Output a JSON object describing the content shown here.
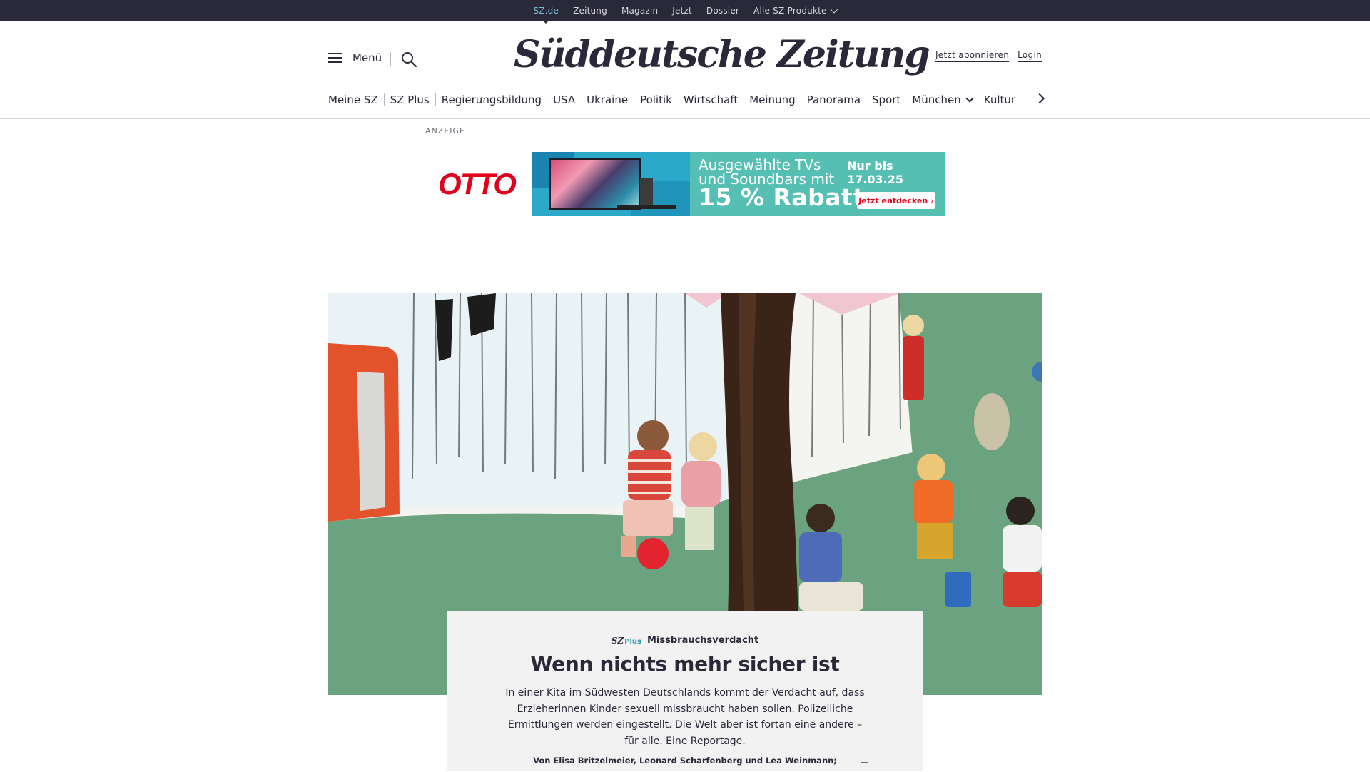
{
  "topbar": {
    "items": [
      {
        "label": "SZ.de",
        "active": true
      },
      {
        "label": "Zeitung"
      },
      {
        "label": "Magazin"
      },
      {
        "label": "Jetzt"
      },
      {
        "label": "Dossier"
      },
      {
        "label": "Alle SZ-Produkte",
        "dropdown": true
      }
    ]
  },
  "header": {
    "menu_label": "Menü",
    "logo": "Süddeutsche Zeitung",
    "subscribe": "Jetzt abonnieren",
    "login": "Login",
    "icons": {
      "menu": "hamburger-icon",
      "search": "search-icon"
    }
  },
  "nav": {
    "items": [
      "Meine SZ",
      "SZ Plus",
      "Regierungsbildung",
      "USA",
      "Ukraine",
      "Politik",
      "Wirtschaft",
      "Meinung",
      "Panorama",
      "Sport",
      "München",
      "Kultur"
    ]
  },
  "ad": {
    "label": "ANZEIGE",
    "brand": "OTTO",
    "headline": "Ausgewählte TVs und Soundbars mit",
    "offer": "15 % Rabatt",
    "date": "Nur bis 17.03.25",
    "cta": "Jetzt entdecken"
  },
  "teaser": {
    "brand": "SZ",
    "brand_suffix": "Plus",
    "kicker": "Missbrauchsverdacht",
    "headline": "Wenn nichts mehr sicher ist",
    "summary": "In einer Kita im Südwesten Deutschlands kommt der Verdacht auf, dass Erzieherinnen Kinder sexuell missbraucht haben sollen. Polizeiliche Ermittlungen werden eingestellt. Die Welt aber ist fortan eine andere – für alle. Eine Reportage.",
    "byline": "Von Elisa Britzelmeier, Leonard Scharfenberg und Lea Weinmann;"
  },
  "colors": {
    "dark": "#29293a",
    "accent": "#71c3d1",
    "otto_red": "#e3001b",
    "ad_green": "#55bfb4",
    "teaser_bg": "#f2f2f3"
  }
}
